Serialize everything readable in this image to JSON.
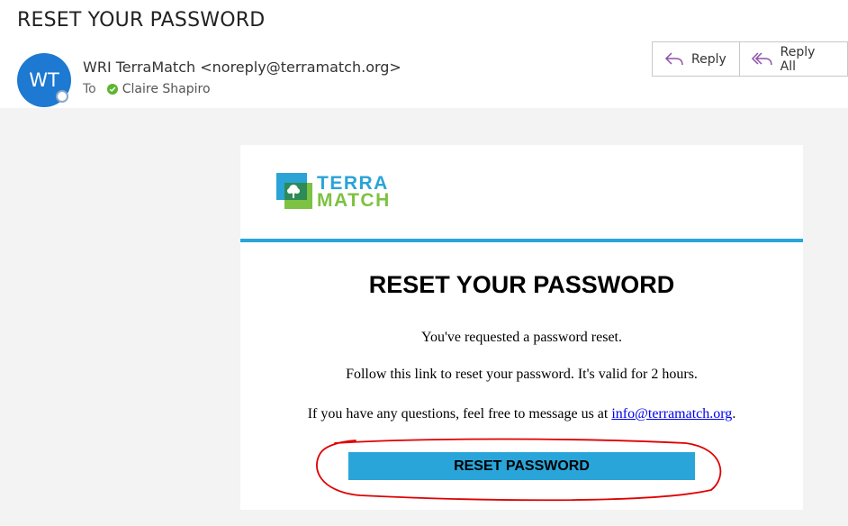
{
  "email": {
    "subject": "RESET YOUR PASSWORD",
    "avatar_initials": "WT",
    "sender": "WRI TerraMatch <noreply@terramatch.org>",
    "to_label": "To",
    "recipient": "Claire Shapiro"
  },
  "actions": {
    "reply_label": "Reply",
    "reply_all_label": "Reply All"
  },
  "message": {
    "logo_line1": "TERRA",
    "logo_line2": "MATCH",
    "title": "RESET YOUR PASSWORD",
    "line1": "You've requested a password reset.",
    "line2": "Follow this link to reset your password. It's valid for 2 hours.",
    "line3_prefix": "If you have any questions, feel free to message us at ",
    "line3_link": "info@terramatch.org",
    "line3_suffix": ".",
    "button_label": "RESET PASSWORD"
  },
  "colors": {
    "avatar": "#1d79d1",
    "brand_blue": "#29a5d9",
    "brand_green": "#7dc242",
    "annotation_red": "#e00000"
  }
}
